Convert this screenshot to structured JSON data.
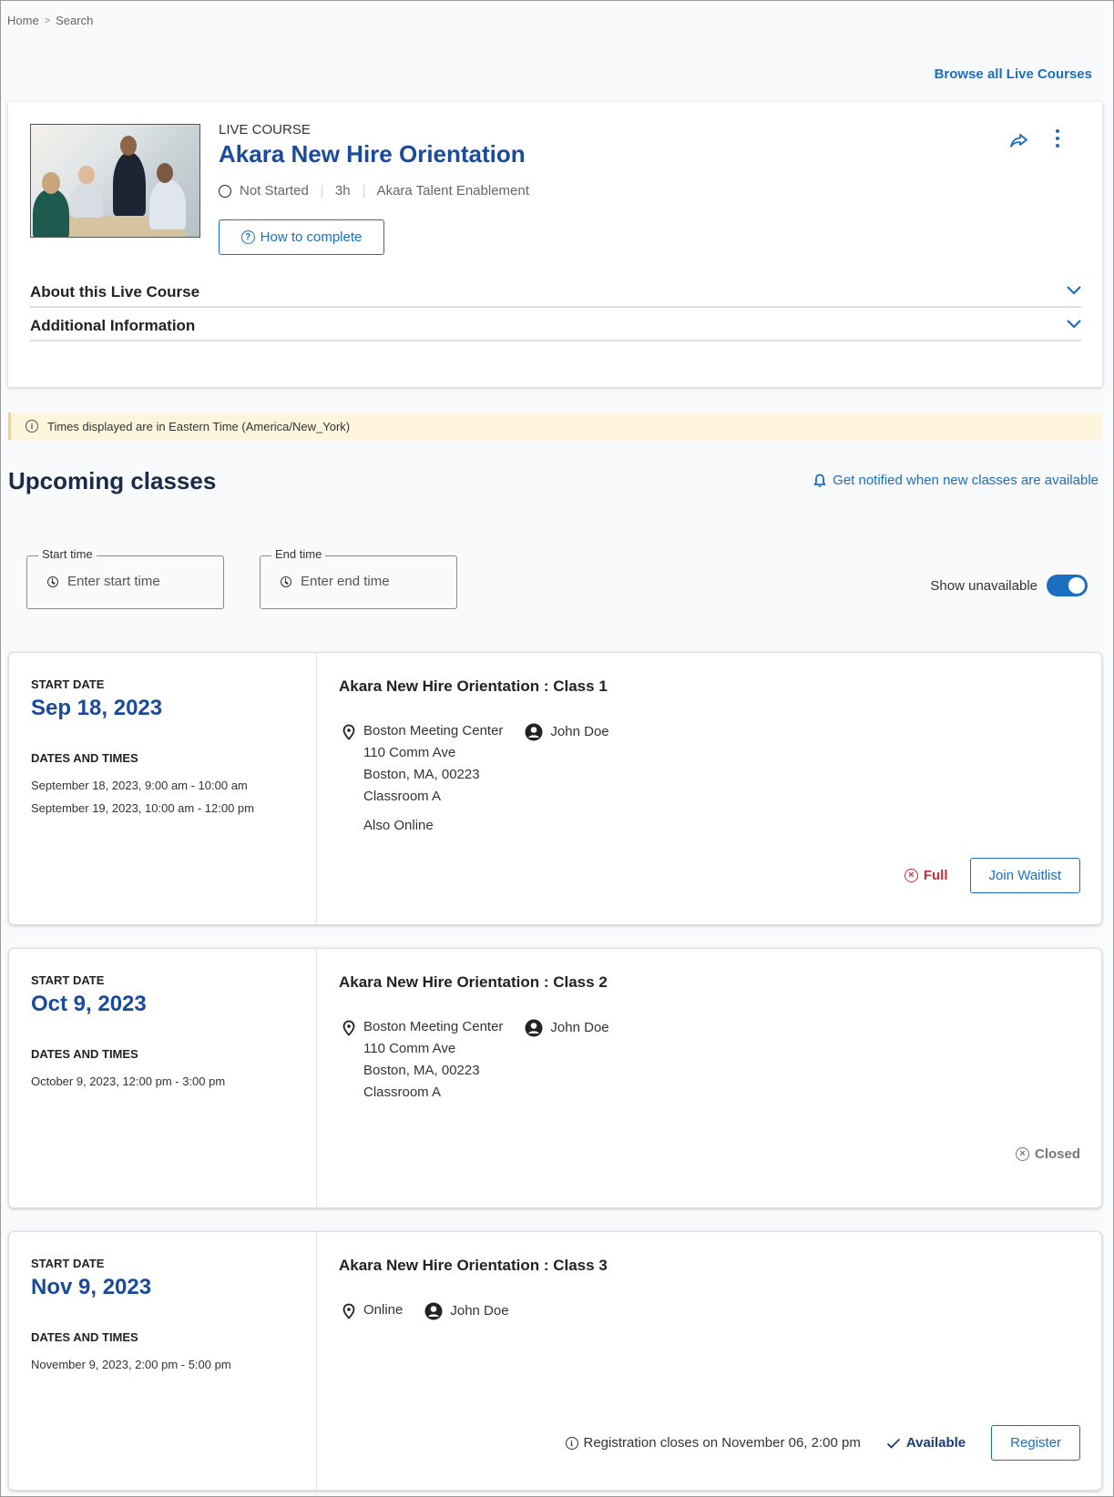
{
  "breadcrumb": {
    "items": [
      "Home",
      "Search"
    ],
    "separator": ">"
  },
  "browse_link": "Browse all Live Courses",
  "course": {
    "kicker": "LIVE COURSE",
    "title": "Akara New Hire Orientation",
    "status": "Not Started",
    "duration": "3h",
    "provider": "Akara Talent Enablement",
    "how_to_complete": "How to complete",
    "icons": {
      "share": "share-icon",
      "more": "more-vertical-icon",
      "thumbnail": "course-thumbnail-image"
    },
    "accordions": [
      {
        "label": "About this Live Course",
        "expanded": false
      },
      {
        "label": "Additional Information",
        "expanded": false
      }
    ]
  },
  "timezone_notice": "Times displayed are in Eastern Time (America/New_York)",
  "upcoming": {
    "title": "Upcoming classes",
    "notify_link": "Get notified when new classes are available",
    "filters": {
      "start": {
        "label": "Start time",
        "placeholder": "Enter start time",
        "value": ""
      },
      "end": {
        "label": "End time",
        "placeholder": "Enter end time",
        "value": ""
      }
    },
    "show_unavailable": {
      "label": "Show unavailable",
      "on": true
    }
  },
  "labels": {
    "start_date": "START DATE",
    "dates_and_times": "DATES AND TIMES"
  },
  "classes": [
    {
      "start_date": "Sep 18, 2023",
      "dates": [
        "September 18, 2023, 9:00 am - 10:00 am",
        "September 19, 2023, 10:00 am - 12:00 pm"
      ],
      "name": "Akara New Hire Orientation : Class 1",
      "location": [
        "Boston Meeting Center",
        "110 Comm Ave",
        "Boston, MA, 00223",
        "Classroom A"
      ],
      "also": "Also Online",
      "instructor": "John Doe",
      "status": "Full",
      "action": "Join Waitlist"
    },
    {
      "start_date": "Oct 9, 2023",
      "dates": [
        "October 9, 2023, 12:00 pm - 3:00 pm"
      ],
      "name": "Akara New Hire Orientation : Class 2",
      "location": [
        "Boston Meeting Center",
        "110 Comm Ave",
        "Boston, MA, 00223",
        "Classroom A"
      ],
      "instructor": "John Doe",
      "status": "Closed"
    },
    {
      "start_date": "Nov 9, 2023",
      "dates": [
        "November 9, 2023, 2:00 pm - 5:00 pm"
      ],
      "name": "Akara New Hire Orientation : Class 3",
      "location": [
        "Online"
      ],
      "instructor": "John Doe",
      "registration_note": "Registration closes on November 06, 2:00 pm",
      "status": "Available",
      "action": "Register"
    }
  ],
  "colors": {
    "accent": "#1a6fc0",
    "title_blue": "#1a4a9b",
    "full_red": "#c62e36",
    "closed_gray": "#777777",
    "available_navy": "#1a3d7a",
    "banner_bg": "#fff5dd"
  }
}
